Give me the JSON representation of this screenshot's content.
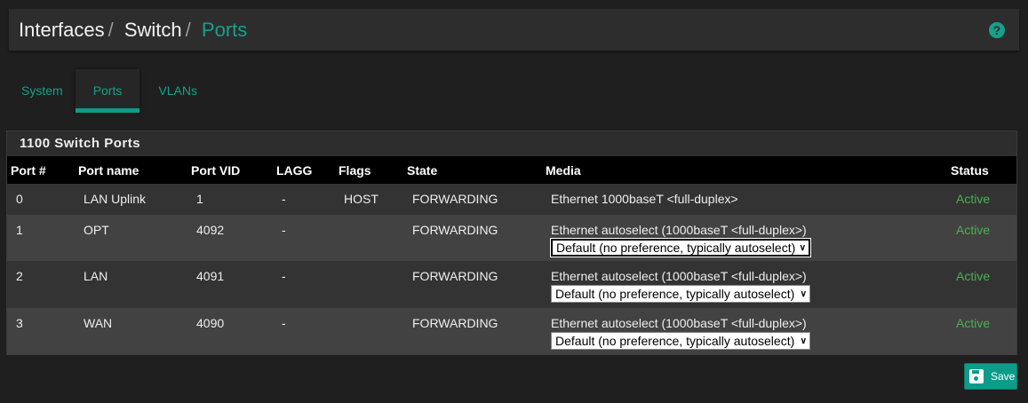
{
  "breadcrumb": {
    "items": [
      "Interfaces",
      "Switch"
    ],
    "current": "Ports"
  },
  "tabs": [
    {
      "label": "System"
    },
    {
      "label": "Ports"
    },
    {
      "label": "VLANs"
    }
  ],
  "panel": {
    "title": "1100 Switch Ports",
    "columns": [
      "Port #",
      "Port name",
      "Port VID",
      "LAGG",
      "Flags",
      "State",
      "Media",
      "Status"
    ],
    "rows": [
      {
        "port": "0",
        "name": "LAN Uplink",
        "vid": "1",
        "lagg": "-",
        "flags": "HOST",
        "state": "FORWARDING",
        "media": "Ethernet 1000baseT <full-duplex>",
        "select": null,
        "status": "Active"
      },
      {
        "port": "1",
        "name": "OPT",
        "vid": "4092",
        "lagg": "-",
        "flags": "",
        "state": "FORWARDING",
        "media": "Ethernet autoselect (1000baseT <full-duplex>)",
        "select": "Default (no preference, typically autoselect)",
        "status": "Active"
      },
      {
        "port": "2",
        "name": "LAN",
        "vid": "4091",
        "lagg": "-",
        "flags": "",
        "state": "FORWARDING",
        "media": "Ethernet autoselect (1000baseT <full-duplex>)",
        "select": "Default (no preference, typically autoselect)",
        "status": "Active"
      },
      {
        "port": "3",
        "name": "WAN",
        "vid": "4090",
        "lagg": "-",
        "flags": "",
        "state": "FORWARDING",
        "media": "Ethernet autoselect (1000baseT <full-duplex>)",
        "select": "Default (no preference, typically autoselect)",
        "status": "Active"
      }
    ]
  },
  "save_label": "Save",
  "colors": {
    "accent": "#0e9c8a",
    "status_active": "#4caf50"
  }
}
